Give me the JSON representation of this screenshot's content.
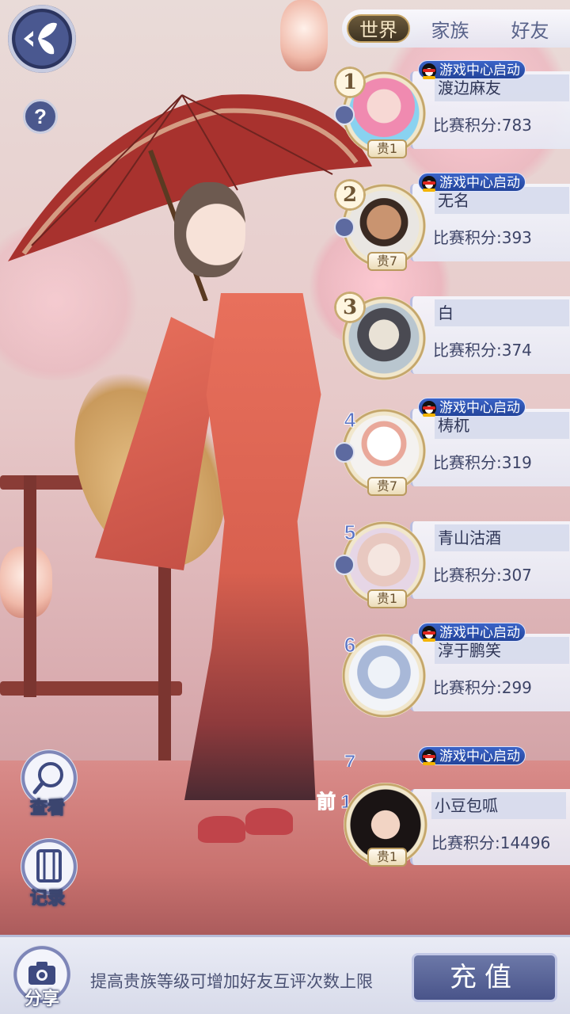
{
  "tabs": [
    {
      "label": "世界",
      "active": true
    },
    {
      "label": "家族",
      "active": false
    },
    {
      "label": "好友",
      "active": false
    }
  ],
  "help": {
    "label": "?"
  },
  "side_buttons": {
    "view_label": "查看",
    "record_label": "记录"
  },
  "launch_tag_text": "游戏中心启动",
  "ranking": [
    {
      "rank": "1",
      "name": "渡边麻友",
      "score": "比赛积分:783",
      "vip": "贵1",
      "launch": true
    },
    {
      "rank": "2",
      "name": "无名",
      "score": "比赛积分:393",
      "vip": "贵7",
      "launch": true
    },
    {
      "rank": "3",
      "name": "白",
      "score": "比赛积分:374",
      "vip": "",
      "launch": false
    },
    {
      "rank": "4",
      "name": "梼杌",
      "score": "比赛积分:319",
      "vip": "贵7",
      "launch": true
    },
    {
      "rank": "5",
      "name": "青山沽酒",
      "score": "比赛积分:307",
      "vip": "贵1",
      "launch": false
    },
    {
      "rank": "6",
      "name": "淳于鹏笑",
      "score": "比赛积分:299",
      "vip": "",
      "launch": true
    },
    {
      "rank": "7",
      "name": "",
      "score": "",
      "vip": "",
      "launch": true
    }
  ],
  "self": {
    "rank_label": "前 1 %",
    "name": "小豆包呱",
    "score": "比赛积分:14496",
    "vip": "贵1"
  },
  "bottom": {
    "share_label": "分享",
    "tip": "提高贵族等级可增加好友互评次数上限",
    "recharge_label": "充值"
  },
  "colors": {
    "accent": "#4b588d",
    "tag_blue": "#2f56b8",
    "card_bg": "#eceef7",
    "dress": "#e06a58"
  }
}
